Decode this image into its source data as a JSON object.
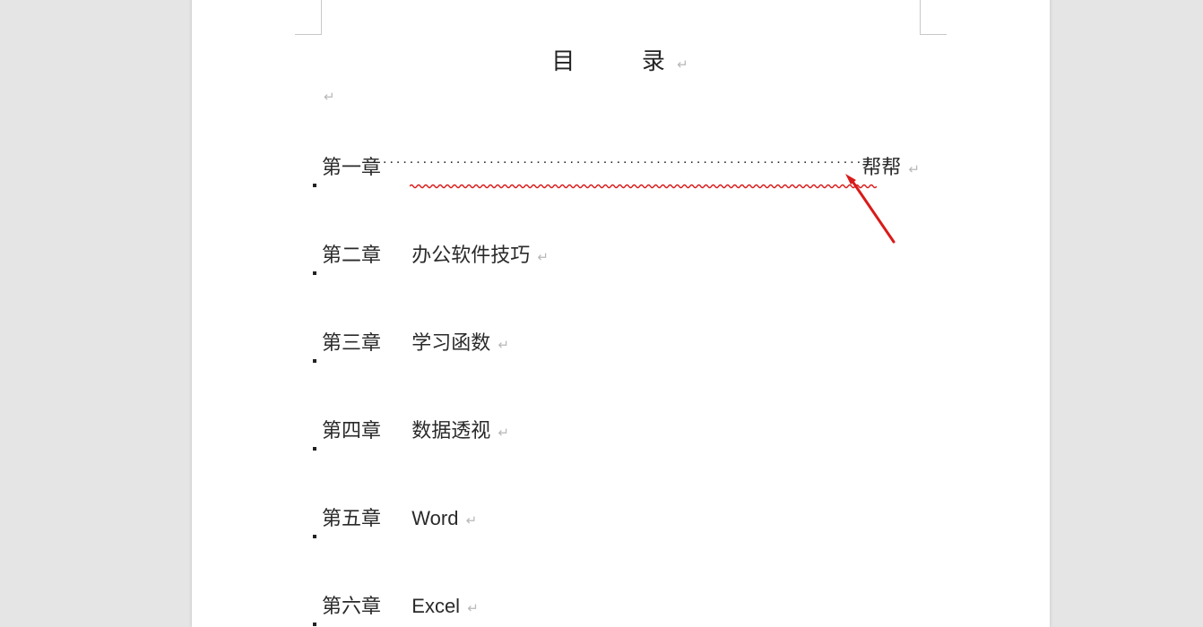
{
  "title": {
    "char1": "目",
    "char2": "录"
  },
  "marks": {
    "return": "↵"
  },
  "toc": [
    {
      "chapter": "第一章",
      "title": "",
      "right": "帮帮",
      "leader": true
    },
    {
      "chapter": "第二章",
      "title": "办公软件技巧",
      "right": "",
      "leader": false
    },
    {
      "chapter": "第三章",
      "title": "学习函数",
      "right": "",
      "leader": false
    },
    {
      "chapter": "第四章",
      "title": "数据透视",
      "right": "",
      "leader": false
    },
    {
      "chapter": "第五章",
      "title": "Word",
      "right": "",
      "leader": false
    },
    {
      "chapter": "第六章",
      "title": "Excel",
      "right": "",
      "leader": false
    }
  ],
  "annotation": {
    "arrow_color": "#d91a1a",
    "squiggle_color": "#d91a1a"
  },
  "dots_string": "........................................................................................................................................................"
}
